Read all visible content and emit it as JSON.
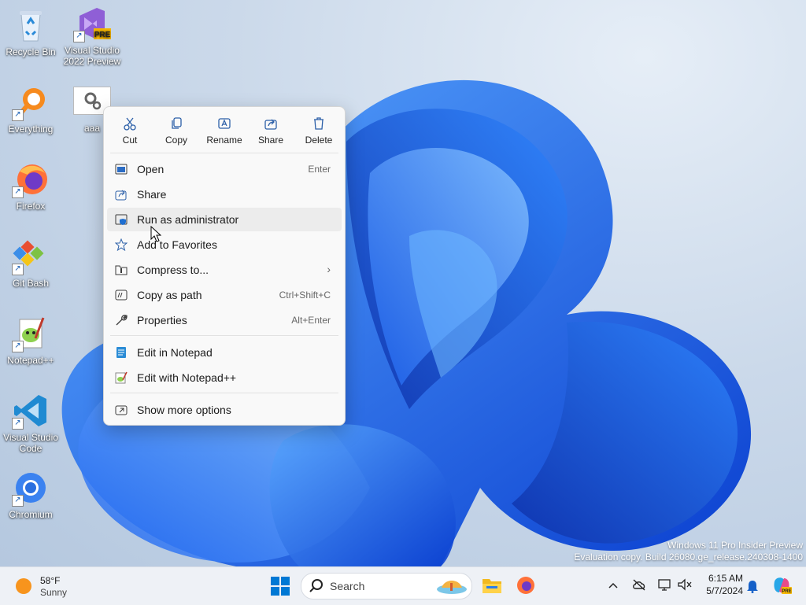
{
  "desktop": {
    "icons": [
      {
        "label": "Recycle Bin"
      },
      {
        "label": "Visual Studio 2022 Preview",
        "badge": "PRE"
      },
      {
        "label": "Everything"
      },
      {
        "label": "aaa"
      },
      {
        "label": "Firefox"
      },
      {
        "label": "Git Bash"
      },
      {
        "label": "Notepad++"
      },
      {
        "label": "Visual Studio Code"
      },
      {
        "label": "Chromium"
      }
    ],
    "watermark": {
      "line1": "Windows 11 Pro Insider Preview",
      "line2": "Evaluation copy. Build 26080.ge_release.240308-1400"
    }
  },
  "context_menu": {
    "quick_actions": [
      {
        "label": "Cut",
        "icon": "scissors-icon"
      },
      {
        "label": "Copy",
        "icon": "copy-icon"
      },
      {
        "label": "Rename",
        "icon": "rename-icon"
      },
      {
        "label": "Share",
        "icon": "share-icon"
      },
      {
        "label": "Delete",
        "icon": "trash-icon"
      }
    ],
    "items": [
      {
        "label": "Open",
        "shortcut": "Enter",
        "icon": "open-window-icon"
      },
      {
        "label": "Share",
        "shortcut": "",
        "icon": "share-icon"
      },
      {
        "label": "Run as administrator",
        "shortcut": "",
        "icon": "shield-icon"
      },
      {
        "label": "Add to Favorites",
        "shortcut": "",
        "icon": "star-icon"
      },
      {
        "label": "Compress to...",
        "shortcut": "",
        "icon": "zip-icon",
        "submenu": true
      },
      {
        "label": "Copy as path",
        "shortcut": "Ctrl+Shift+C",
        "icon": "path-icon"
      },
      {
        "label": "Properties",
        "shortcut": "Alt+Enter",
        "icon": "wrench-icon"
      },
      {
        "label": "Edit in Notepad",
        "shortcut": "",
        "icon": "notepad-icon"
      },
      {
        "label": "Edit with Notepad++",
        "shortcut": "",
        "icon": "notepadpp-icon"
      },
      {
        "label": "Show more options",
        "shortcut": "",
        "icon": "more-options-icon"
      }
    ]
  },
  "taskbar": {
    "weather": {
      "temp": "58°F",
      "condition": "Sunny"
    },
    "search_placeholder": "Search",
    "clock": {
      "time": "6:15 AM",
      "date": "5/7/2024"
    }
  },
  "colors": {
    "accent": "#0067c0",
    "menu_bg": "#f9f9f9",
    "taskbar_bg": "#eef1f6"
  }
}
